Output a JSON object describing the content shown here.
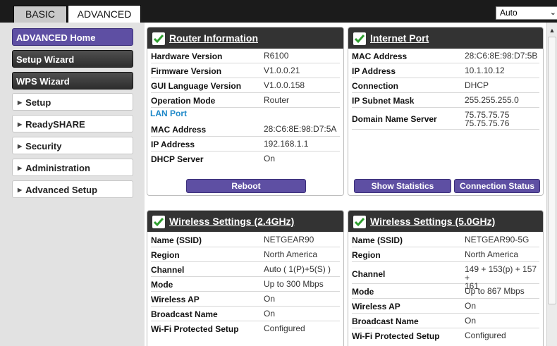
{
  "tabs": {
    "basic": "BASIC",
    "advanced": "ADVANCED"
  },
  "language_select": {
    "value": "Auto"
  },
  "sidebar": {
    "items": [
      {
        "label": "ADVANCED Home"
      },
      {
        "label": "Setup Wizard"
      },
      {
        "label": "WPS Wizard"
      },
      {
        "label": "Setup"
      },
      {
        "label": "ReadySHARE"
      },
      {
        "label": "Security"
      },
      {
        "label": "Administration"
      },
      {
        "label": "Advanced Setup"
      }
    ]
  },
  "router_info": {
    "title": "Router Information",
    "rows": [
      {
        "k": "Hardware Version",
        "v": "R6100"
      },
      {
        "k": "Firmware Version",
        "v": "V1.0.0.21"
      },
      {
        "k": "GUI Language Version",
        "v": "V1.0.0.158"
      },
      {
        "k": "Operation Mode",
        "v": "Router"
      }
    ],
    "lan_label": "LAN Port",
    "lan_rows": [
      {
        "k": "MAC Address",
        "v": "28:C6:8E:98:D7:5A"
      },
      {
        "k": "IP Address",
        "v": "192.168.1.1"
      },
      {
        "k": "DHCP Server",
        "v": "On"
      }
    ],
    "button": "Reboot"
  },
  "internet_port": {
    "title": "Internet Port",
    "rows": [
      {
        "k": "MAC Address",
        "v": "28:C6:8E:98:D7:5B"
      },
      {
        "k": "IP Address",
        "v": "10.1.10.12"
      },
      {
        "k": "Connection",
        "v": "DHCP"
      },
      {
        "k": "IP Subnet Mask",
        "v": "255.255.255.0"
      }
    ],
    "dns": {
      "k": "Domain Name Server",
      "v1": "75.75.75.75",
      "v2": "75.75.75.76"
    },
    "buttons": {
      "stats": "Show Statistics",
      "status": "Connection Status"
    }
  },
  "wireless_24": {
    "title": "Wireless Settings (2.4GHz)",
    "rows": [
      {
        "k": "Name (SSID)",
        "v": "NETGEAR90"
      },
      {
        "k": "Region",
        "v": "North America"
      },
      {
        "k": "Channel",
        "v": "Auto ( 1(P)+5(S) )"
      },
      {
        "k": "Mode",
        "v": "Up to 300 Mbps"
      },
      {
        "k": "Wireless AP",
        "v": "On"
      },
      {
        "k": "Broadcast Name",
        "v": "On"
      },
      {
        "k": "Wi-Fi Protected Setup",
        "v": "Configured"
      }
    ]
  },
  "wireless_50": {
    "title": "Wireless Settings (5.0GHz)",
    "rows": [
      {
        "k": "Name (SSID)",
        "v": "NETGEAR90-5G"
      },
      {
        "k": "Region",
        "v": "North America"
      },
      {
        "k": "Channel",
        "v1": "149 + 153(p) + 157 +",
        "v2": "161"
      },
      {
        "k": "Mode",
        "v": "Up to 867 Mbps"
      },
      {
        "k": "Wireless AP",
        "v": "On"
      },
      {
        "k": "Broadcast Name",
        "v": "On"
      },
      {
        "k": "Wi-Fi Protected Setup",
        "v": "Configured"
      }
    ]
  }
}
